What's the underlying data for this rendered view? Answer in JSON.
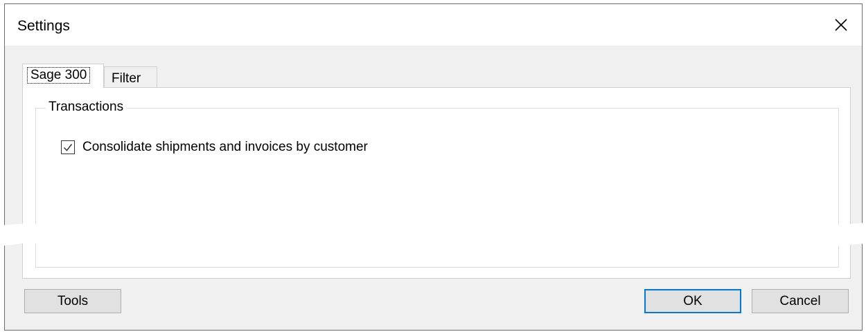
{
  "window": {
    "title": "Settings"
  },
  "tabs": [
    {
      "label": "Sage 300",
      "selected": true
    },
    {
      "label": "Filter",
      "selected": false
    }
  ],
  "group": {
    "title": "Transactions",
    "checkbox": {
      "label": "Consolidate shipments and invoices by customer",
      "checked": true
    }
  },
  "buttons": {
    "tools": "Tools",
    "ok": "OK",
    "cancel": "Cancel"
  },
  "colors": {
    "accent": "#0078d7",
    "dialog_bg": "#f0f0f0"
  },
  "icons": {
    "close": "close-icon",
    "check": "checkmark-icon"
  }
}
